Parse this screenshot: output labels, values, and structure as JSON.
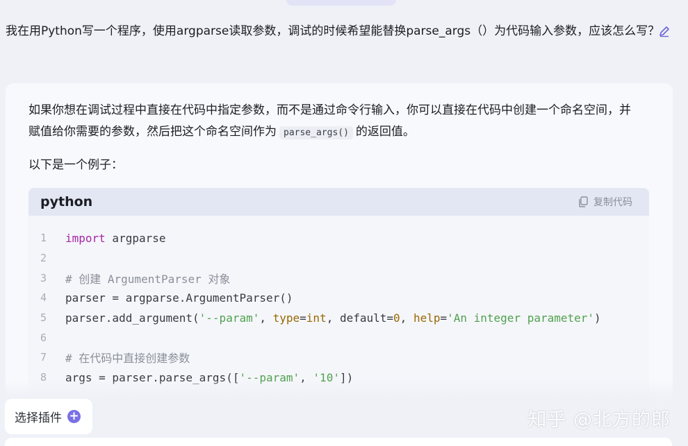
{
  "user_message": {
    "text": "我在用Python写一个程序，使用argparse读取参数，调试的时候希望能替换parse_args（）为代码输入参数，应该怎么写？"
  },
  "answer": {
    "p1_before": "如果你想在调试过程中直接在代码中指定参数，而不是通过命令行输入，你可以直接在代码中创建一个命名空间，并赋值给你需要的参数，然后把这个命名空间作为",
    "p1_code": "parse_args()",
    "p1_after": "的返回值。",
    "p2": "以下是一个例子："
  },
  "code_block": {
    "language": "python",
    "copy_label": "复制代码",
    "lines": [
      {
        "n": "1"
      },
      {
        "n": "2"
      },
      {
        "n": "3"
      },
      {
        "n": "4"
      },
      {
        "n": "5"
      },
      {
        "n": "6"
      },
      {
        "n": "7"
      },
      {
        "n": "8"
      }
    ],
    "tokens": {
      "l1_kw": "import",
      "l1_rest": " argparse",
      "l3": "# 创建 ArgumentParser 对象",
      "l4": "parser = argparse.ArgumentParser()",
      "l5_a": "parser.add_argument(",
      "l5_s1": "'--param'",
      "l5_b": ", ",
      "l5_k1": "type",
      "l5_c": "=",
      "l5_k2": "int",
      "l5_d": ", default=",
      "l5_n": "0",
      "l5_e": ", ",
      "l5_k3": "help",
      "l5_f": "=",
      "l5_s2": "'An integer parameter'",
      "l5_g": ")",
      "l7": "# 在代码中直接创建参数",
      "l8_a": "args = parser.parse_args([",
      "l8_s1": "'--param'",
      "l8_b": ", ",
      "l8_s2": "'10'",
      "l8_c": "])"
    }
  },
  "plugin_button": {
    "label": "选择插件"
  },
  "watermark": "知乎 @北方的郎",
  "colors": {
    "accent": "#7a70e5",
    "keyword": "#a626a4",
    "string": "#50a14f"
  }
}
